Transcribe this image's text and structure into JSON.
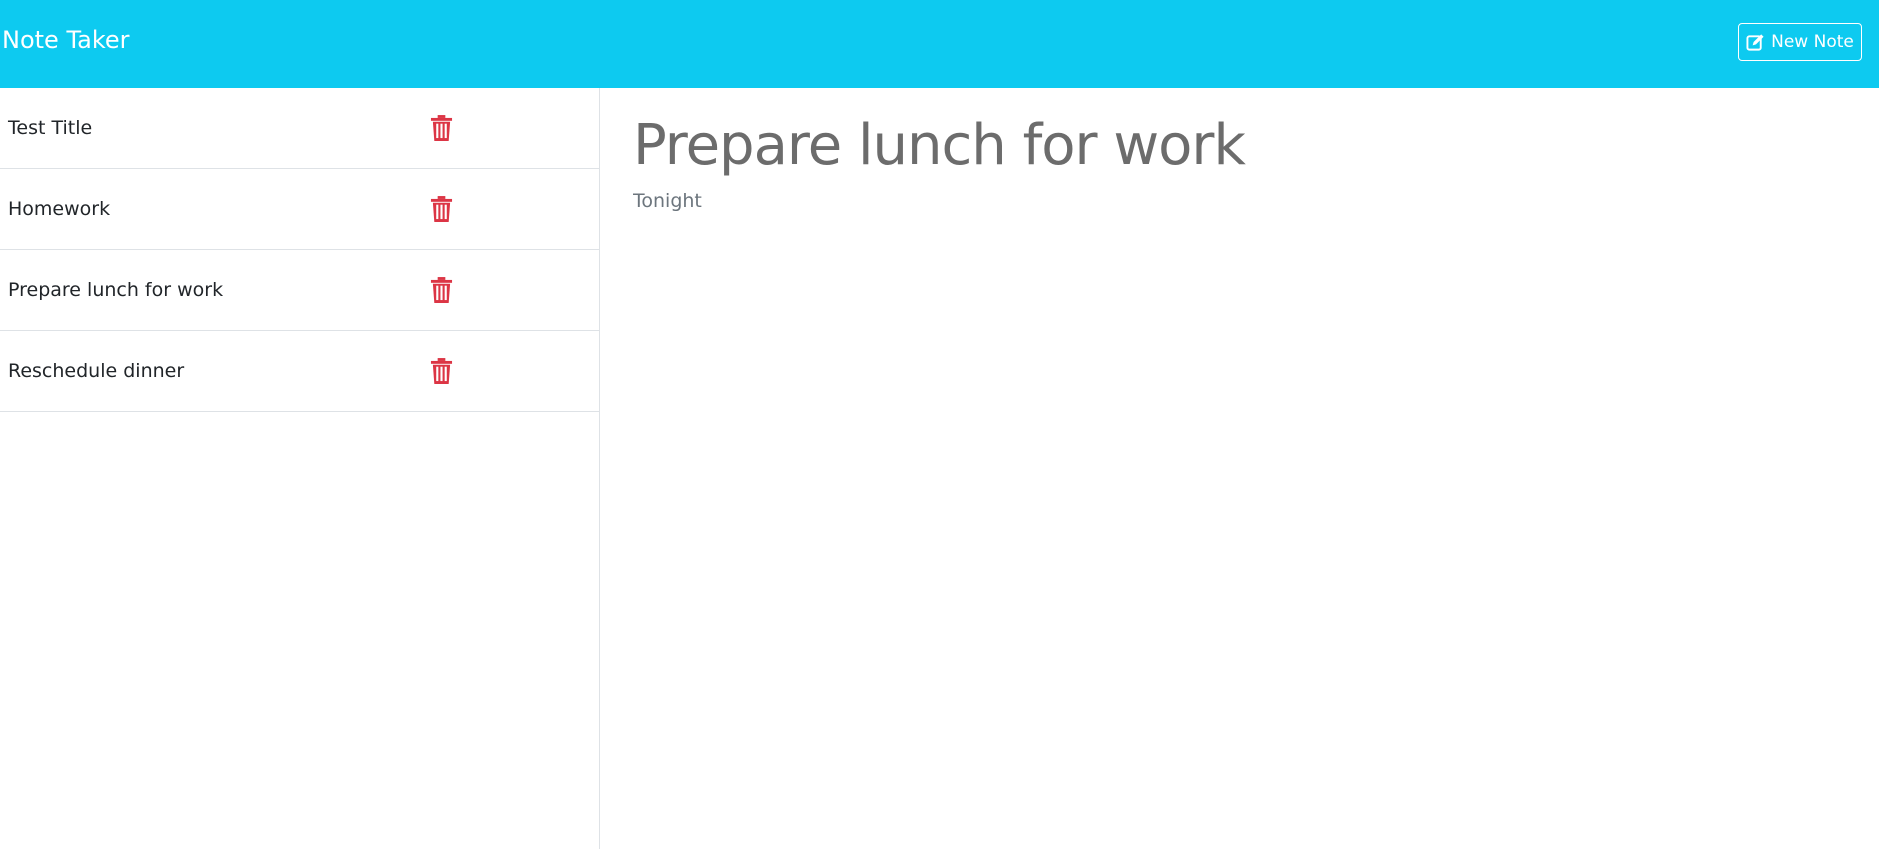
{
  "header": {
    "brand": "Note Taker",
    "new_note_label": "New Note",
    "new_note_icon": "pen-to-square-icon",
    "background_color": "#0dcaf0"
  },
  "notes": [
    {
      "title": "Test Title",
      "delete_icon": "trash-icon"
    },
    {
      "title": "Homework",
      "delete_icon": "trash-icon"
    },
    {
      "title": "Prepare lunch for work",
      "delete_icon": "trash-icon"
    },
    {
      "title": "Reschedule dinner",
      "delete_icon": "trash-icon"
    }
  ],
  "active_note": {
    "title": "Prepare lunch for work",
    "text": "Tonight"
  },
  "colors": {
    "delete": "#dc3545",
    "text": "#212529"
  }
}
